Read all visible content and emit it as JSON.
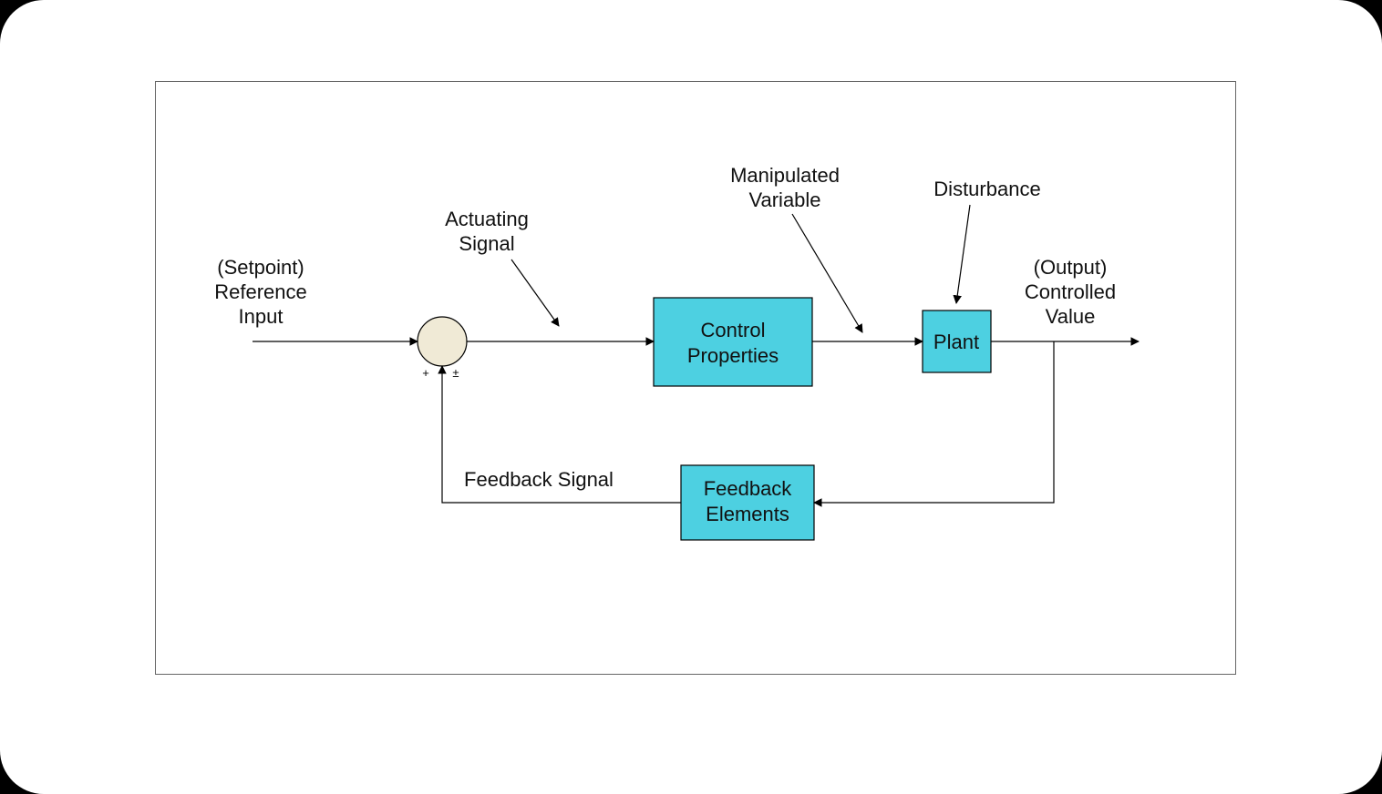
{
  "labels": {
    "setpoint_l1": "(Setpoint)",
    "setpoint_l2": "Reference",
    "setpoint_l3": "Input",
    "actuating_l1": "Actuating",
    "actuating_l2": "Signal",
    "manip_l1": "Manipulated",
    "manip_l2": "Variable",
    "disturbance": "Disturbance",
    "output_l1": "(Output)",
    "output_l2": "Controlled",
    "output_l3": "Value",
    "feedback_signal": "Feedback Signal",
    "plus": "+",
    "plusminus": "±"
  },
  "blocks": {
    "control_l1": "Control",
    "control_l2": "Properties",
    "plant": "Plant",
    "feedback_l1": "Feedback",
    "feedback_l2": "Elements"
  }
}
